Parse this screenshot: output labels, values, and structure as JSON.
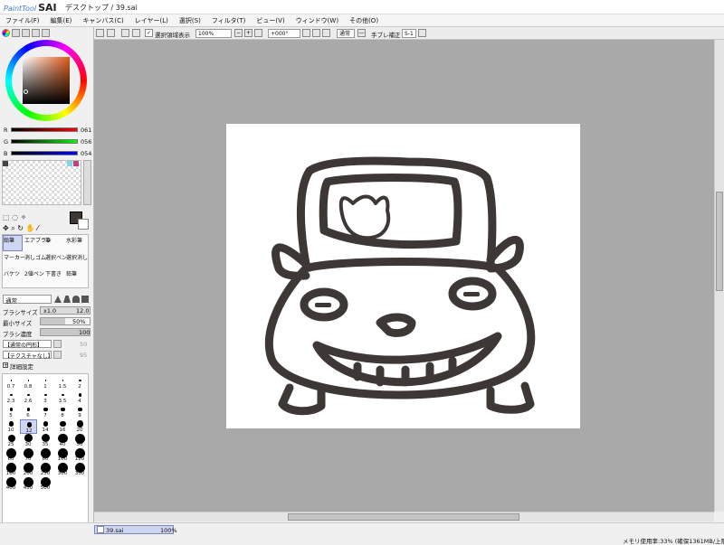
{
  "app": {
    "logo_text": "PaintTool",
    "logo_bold": "SAI",
    "doc_title": "デスクトップ / 39.sai"
  },
  "menu": [
    "ファイル(F)",
    "編集(E)",
    "キャンバス(C)",
    "レイヤー(L)",
    "選択(S)",
    "フィルタ(T)",
    "ビュー(V)",
    "ウィンドウ(W)",
    "その他(O)"
  ],
  "toolbar": {
    "show_selection_label": "選択領域表示",
    "zoom": "100%",
    "rotation": "+000°",
    "blend": "通常",
    "stabilizer_label": "手ブレ補正",
    "stabilizer_value": "S-1"
  },
  "color": {
    "r_label": "R",
    "g_label": "G",
    "b_label": "B",
    "r": "061",
    "g": "056",
    "b": "054",
    "current": "#3d3836"
  },
  "tools": {
    "row1": [
      "鉛筆",
      "エアブラシ",
      "筆",
      "水彩筆"
    ],
    "row2": [
      "マーカー",
      "消しゴム",
      "選択ペン",
      "選択消し"
    ],
    "row3": [
      "バケツ",
      "2値ペン",
      "下書き",
      "鉛筆"
    ]
  },
  "brush": {
    "mode": "通常",
    "size_label": "ブラシサイズ",
    "size_mult": "x1.0",
    "size_value": "12.0",
    "min_label": "最小サイズ",
    "min_value": "50%",
    "density_label": "ブラシ濃度",
    "density_value": "100",
    "shape": "【通常の円形】",
    "shape_val": "50",
    "texture": "【テクスチャなし】",
    "texture_val": "95",
    "detail": "詳細設定"
  },
  "brush_sizes": [
    "0.7",
    "0.8",
    "1",
    "1.5",
    "2",
    "2.3",
    "2.6",
    "3",
    "3.5",
    "4",
    "5",
    "6",
    "7",
    "8",
    "9",
    "10",
    "12",
    "14",
    "16",
    "20",
    "25",
    "30",
    "35",
    "40",
    "50",
    "60",
    "70",
    "80",
    "100",
    "120",
    "160",
    "200",
    "250",
    "300",
    "350",
    "400",
    "450",
    "500"
  ],
  "selected_brush_size": "12",
  "document_tab": {
    "name": "39.sai",
    "zoom": "100%"
  },
  "status": {
    "memory": "メモリ使用率:33% (確保1361MB/上限40"
  }
}
